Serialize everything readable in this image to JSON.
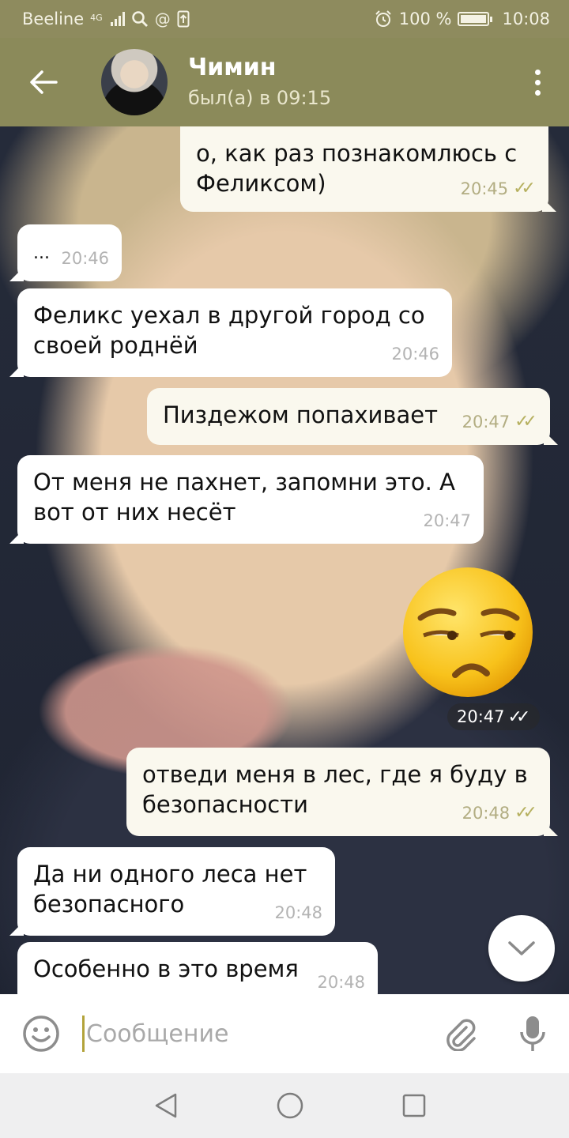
{
  "status_bar": {
    "carrier": "Beeline",
    "network": "4G",
    "battery": "100 %",
    "battery_level": 1.0,
    "time": "10:08",
    "icons": [
      "signal-icon",
      "search-icon",
      "at-icon",
      "upload-icon",
      "alarm-icon",
      "battery-icon"
    ]
  },
  "header": {
    "contact_name": "Чимин",
    "last_seen": "был(а) в 09:15",
    "icons": [
      "back-arrow-icon",
      "avatar",
      "more-vertical-icon"
    ]
  },
  "messages": [
    {
      "direction": "out",
      "text": "о, как раз познакомлюсь с Феликсом)",
      "time": "20:45",
      "read": true
    },
    {
      "direction": "in",
      "text": "...",
      "time": "20:46"
    },
    {
      "direction": "in",
      "text": "Феликс уехал в другой город со своей роднёй",
      "time": "20:46"
    },
    {
      "direction": "out",
      "text": "Пиздежом попахивает",
      "time": "20:47",
      "read": true
    },
    {
      "direction": "in",
      "text": "От меня не пахнет, запомни это. А вот от них несёт",
      "time": "20:47"
    },
    {
      "direction": "out",
      "type": "emoji",
      "emoji": "unamused-face-icon",
      "time": "20:47",
      "read": true
    },
    {
      "direction": "out",
      "text": "отведи меня в лес, где я буду в безопасности",
      "time": "20:48",
      "read": true
    },
    {
      "direction": "in",
      "text": "Да ни одного леса нет безопасного",
      "time": "20:48"
    },
    {
      "direction": "in",
      "text": "Особенно в это время",
      "time": "20:48"
    }
  ],
  "input": {
    "placeholder": "Сообщение",
    "icons": [
      "emoji-icon",
      "attach-icon",
      "microphone-icon"
    ]
  },
  "colors": {
    "header": "#8b8a5a",
    "status_bar": "#8e8b5e",
    "outgoing_bubble": "#faf8ee",
    "incoming_bubble": "#ffffff",
    "read_check": "#b6b05f",
    "caret": "#b3a33a"
  }
}
